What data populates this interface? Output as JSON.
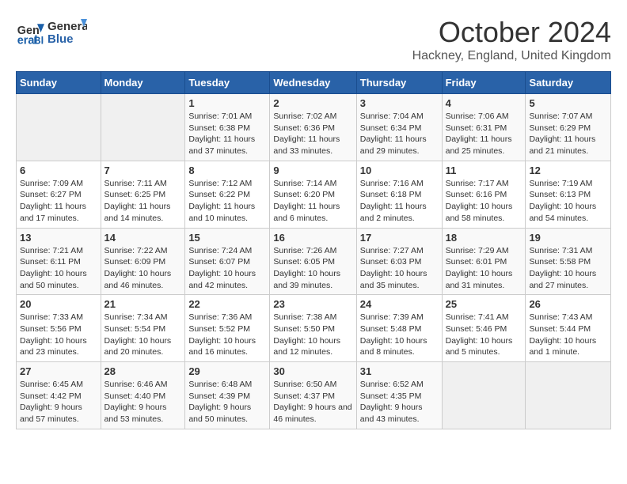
{
  "header": {
    "logo_line1": "General",
    "logo_line2": "Blue",
    "month": "October 2024",
    "location": "Hackney, England, United Kingdom"
  },
  "weekdays": [
    "Sunday",
    "Monday",
    "Tuesday",
    "Wednesday",
    "Thursday",
    "Friday",
    "Saturday"
  ],
  "weeks": [
    [
      {
        "day": "",
        "info": ""
      },
      {
        "day": "",
        "info": ""
      },
      {
        "day": "1",
        "info": "Sunrise: 7:01 AM\nSunset: 6:38 PM\nDaylight: 11 hours and 37 minutes."
      },
      {
        "day": "2",
        "info": "Sunrise: 7:02 AM\nSunset: 6:36 PM\nDaylight: 11 hours and 33 minutes."
      },
      {
        "day": "3",
        "info": "Sunrise: 7:04 AM\nSunset: 6:34 PM\nDaylight: 11 hours and 29 minutes."
      },
      {
        "day": "4",
        "info": "Sunrise: 7:06 AM\nSunset: 6:31 PM\nDaylight: 11 hours and 25 minutes."
      },
      {
        "day": "5",
        "info": "Sunrise: 7:07 AM\nSunset: 6:29 PM\nDaylight: 11 hours and 21 minutes."
      }
    ],
    [
      {
        "day": "6",
        "info": "Sunrise: 7:09 AM\nSunset: 6:27 PM\nDaylight: 11 hours and 17 minutes."
      },
      {
        "day": "7",
        "info": "Sunrise: 7:11 AM\nSunset: 6:25 PM\nDaylight: 11 hours and 14 minutes."
      },
      {
        "day": "8",
        "info": "Sunrise: 7:12 AM\nSunset: 6:22 PM\nDaylight: 11 hours and 10 minutes."
      },
      {
        "day": "9",
        "info": "Sunrise: 7:14 AM\nSunset: 6:20 PM\nDaylight: 11 hours and 6 minutes."
      },
      {
        "day": "10",
        "info": "Sunrise: 7:16 AM\nSunset: 6:18 PM\nDaylight: 11 hours and 2 minutes."
      },
      {
        "day": "11",
        "info": "Sunrise: 7:17 AM\nSunset: 6:16 PM\nDaylight: 10 hours and 58 minutes."
      },
      {
        "day": "12",
        "info": "Sunrise: 7:19 AM\nSunset: 6:13 PM\nDaylight: 10 hours and 54 minutes."
      }
    ],
    [
      {
        "day": "13",
        "info": "Sunrise: 7:21 AM\nSunset: 6:11 PM\nDaylight: 10 hours and 50 minutes."
      },
      {
        "day": "14",
        "info": "Sunrise: 7:22 AM\nSunset: 6:09 PM\nDaylight: 10 hours and 46 minutes."
      },
      {
        "day": "15",
        "info": "Sunrise: 7:24 AM\nSunset: 6:07 PM\nDaylight: 10 hours and 42 minutes."
      },
      {
        "day": "16",
        "info": "Sunrise: 7:26 AM\nSunset: 6:05 PM\nDaylight: 10 hours and 39 minutes."
      },
      {
        "day": "17",
        "info": "Sunrise: 7:27 AM\nSunset: 6:03 PM\nDaylight: 10 hours and 35 minutes."
      },
      {
        "day": "18",
        "info": "Sunrise: 7:29 AM\nSunset: 6:01 PM\nDaylight: 10 hours and 31 minutes."
      },
      {
        "day": "19",
        "info": "Sunrise: 7:31 AM\nSunset: 5:58 PM\nDaylight: 10 hours and 27 minutes."
      }
    ],
    [
      {
        "day": "20",
        "info": "Sunrise: 7:33 AM\nSunset: 5:56 PM\nDaylight: 10 hours and 23 minutes."
      },
      {
        "day": "21",
        "info": "Sunrise: 7:34 AM\nSunset: 5:54 PM\nDaylight: 10 hours and 20 minutes."
      },
      {
        "day": "22",
        "info": "Sunrise: 7:36 AM\nSunset: 5:52 PM\nDaylight: 10 hours and 16 minutes."
      },
      {
        "day": "23",
        "info": "Sunrise: 7:38 AM\nSunset: 5:50 PM\nDaylight: 10 hours and 12 minutes."
      },
      {
        "day": "24",
        "info": "Sunrise: 7:39 AM\nSunset: 5:48 PM\nDaylight: 10 hours and 8 minutes."
      },
      {
        "day": "25",
        "info": "Sunrise: 7:41 AM\nSunset: 5:46 PM\nDaylight: 10 hours and 5 minutes."
      },
      {
        "day": "26",
        "info": "Sunrise: 7:43 AM\nSunset: 5:44 PM\nDaylight: 10 hours and 1 minute."
      }
    ],
    [
      {
        "day": "27",
        "info": "Sunrise: 6:45 AM\nSunset: 4:42 PM\nDaylight: 9 hours and 57 minutes."
      },
      {
        "day": "28",
        "info": "Sunrise: 6:46 AM\nSunset: 4:40 PM\nDaylight: 9 hours and 53 minutes."
      },
      {
        "day": "29",
        "info": "Sunrise: 6:48 AM\nSunset: 4:39 PM\nDaylight: 9 hours and 50 minutes."
      },
      {
        "day": "30",
        "info": "Sunrise: 6:50 AM\nSunset: 4:37 PM\nDaylight: 9 hours and 46 minutes."
      },
      {
        "day": "31",
        "info": "Sunrise: 6:52 AM\nSunset: 4:35 PM\nDaylight: 9 hours and 43 minutes."
      },
      {
        "day": "",
        "info": ""
      },
      {
        "day": "",
        "info": ""
      }
    ]
  ]
}
